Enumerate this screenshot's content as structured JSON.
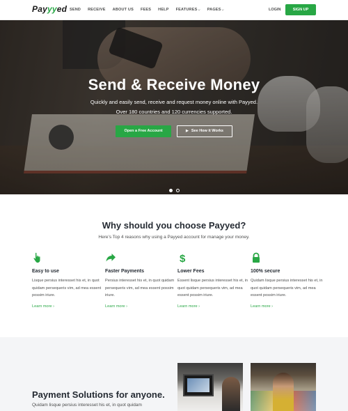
{
  "header": {
    "logo": {
      "prefix": "Pay",
      "accent": "yy",
      "suffix": "ed"
    },
    "nav": [
      {
        "label": "SEND",
        "dropdown": false
      },
      {
        "label": "RECEIVE",
        "dropdown": false
      },
      {
        "label": "ABOUT US",
        "dropdown": false
      },
      {
        "label": "FEES",
        "dropdown": false
      },
      {
        "label": "HELP",
        "dropdown": false
      },
      {
        "label": "FEATURES",
        "dropdown": true
      },
      {
        "label": "PAGES",
        "dropdown": true
      }
    ],
    "login_label": "LOGIN",
    "signup_label": "SIGN UP"
  },
  "hero": {
    "title": "Send & Receive Money",
    "subtitle_line1": "Quickly and easily send, receive and request money online with Payyed.",
    "subtitle_line2": "Over 180 countries and 120 currencies supported.",
    "primary_button": "Open a Free Account",
    "secondary_button": "See How it Works",
    "slides": 2,
    "active_slide": 1
  },
  "why": {
    "title": "Why should you choose Payyed?",
    "subtitle": "Here’s Top 4 reasons why using a Payyed account for manage your money.",
    "features": [
      {
        "icon": "hand-pointer-icon",
        "title": "Easy to use",
        "text": "Lisque persius interesset his et, in quot quidam persequeris vim, ad mea essent possim iriure.",
        "link": "Learn more"
      },
      {
        "icon": "share-arrow-icon",
        "title": "Faster Payments",
        "text": "Persius interesset his et, in quot quidam persequeris vim, ad mea essent possim iriure.",
        "link": "Learn more"
      },
      {
        "icon": "dollar-icon",
        "title": "Lower Fees",
        "text": "Essent lisque persius interesset his et, in quot quidam persequeris vim, ad mea essent possim iriure.",
        "link": "Learn more"
      },
      {
        "icon": "lock-icon",
        "title": "100% secure",
        "text": "Quidam lisque persius interesset his et, in quot quidam persequeris vim, ad mea essent possim iriure.",
        "link": "Learn more"
      }
    ]
  },
  "payment": {
    "title": "Payment Solutions for anyone.",
    "text": "Quidam lisque persius interesset his et, in quot quidam"
  },
  "colors": {
    "accent": "#28a745",
    "heading": "#252b33",
    "body_text": "#4c4d4d",
    "section_bg": "#f4f5f7"
  }
}
